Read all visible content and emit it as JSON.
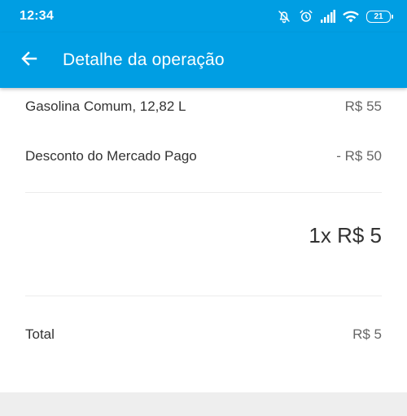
{
  "status_bar": {
    "time": "12:34",
    "battery": "21",
    "icons": [
      "alarm-off-icon",
      "alarm-clock-icon",
      "signal-icon",
      "wifi-icon",
      "battery-icon"
    ]
  },
  "app_bar": {
    "title": "Detalhe da operação",
    "back_icon": "arrow-left-icon"
  },
  "items": [
    {
      "label": "Gasolina Comum, 12,82 L",
      "value": "R$ 55"
    },
    {
      "label": "Desconto do Mercado Pago",
      "value": "- R$ 50"
    }
  ],
  "installments": "1x R$ 5",
  "total": {
    "label": "Total",
    "value": "R$ 5"
  },
  "colors": {
    "primary": "#009ee3",
    "text": "#333333",
    "secondary_text": "#666666",
    "background_bottom": "#eeeeee"
  }
}
